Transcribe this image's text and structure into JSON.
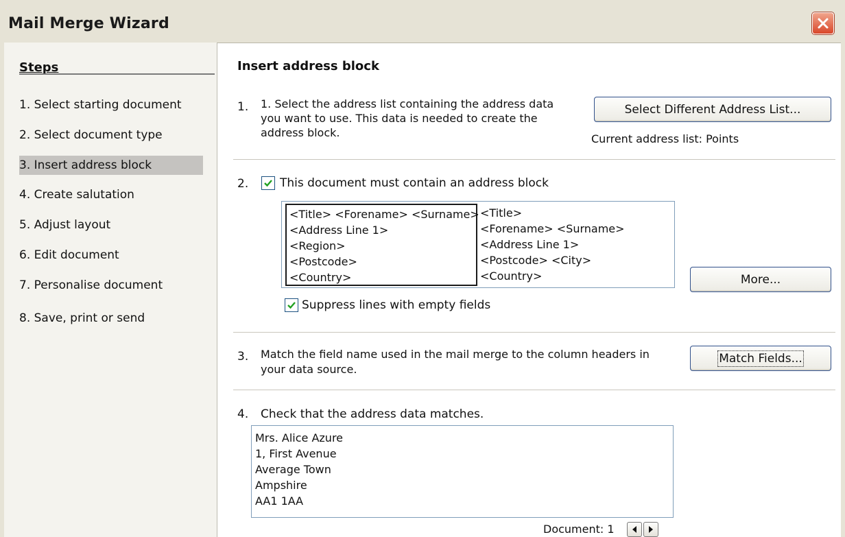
{
  "window": {
    "title": "Mail Merge Wizard",
    "close_icon": "close-icon"
  },
  "steps": {
    "heading": "Steps",
    "items": [
      {
        "label": "1.  Select starting document",
        "active": false
      },
      {
        "label": "2.  Select document type",
        "active": false
      },
      {
        "label": "3.  Insert address block",
        "active": true
      },
      {
        "label": "4.  Create salutation",
        "active": false
      },
      {
        "label": "5.  Adjust layout",
        "active": false
      },
      {
        "label": "6.  Edit document",
        "active": false
      },
      {
        "label": "7.  Personalise document",
        "active": false
      },
      {
        "label": "8.  Save, print or send",
        "active": false
      }
    ]
  },
  "main": {
    "heading": "Insert address block",
    "section1": {
      "number": "1.",
      "lines": [
        "1. Select the address list containing the address data",
        "you want to use. This data is needed to create the",
        "address block."
      ],
      "button_label": "Select Different Address List...",
      "current_list": "Current address list: Points"
    },
    "section2": {
      "number": "2.",
      "checkbox_label": "This document must contain an address block",
      "checkbox_checked": true,
      "block_option_1": [
        "<Title> <Forename> <Surname>",
        "<Address Line 1>",
        "<Region>",
        " <Postcode>",
        " <Country>"
      ],
      "block_option_2": [
        "<Title>",
        "<Forename> <Surname>",
        "<Address Line 1>",
        "<Postcode> <City>",
        "<Country>"
      ],
      "more_button": "More...",
      "suppress_label": "Suppress lines with empty fields",
      "suppress_checked": true
    },
    "section3": {
      "number": "3.",
      "lines": [
        "Match the field name used in the mail merge to the column headers in",
        "your data source."
      ],
      "button_label": "Match Fields..."
    },
    "section4": {
      "number": "4.",
      "label": "Check that the address data matches.",
      "preview": [
        "Mrs. Alice Azure",
        "1, First Avenue",
        "Average Town",
        "Ampshire",
        " AA1 1AA"
      ],
      "document_label": "Document: 1"
    }
  }
}
